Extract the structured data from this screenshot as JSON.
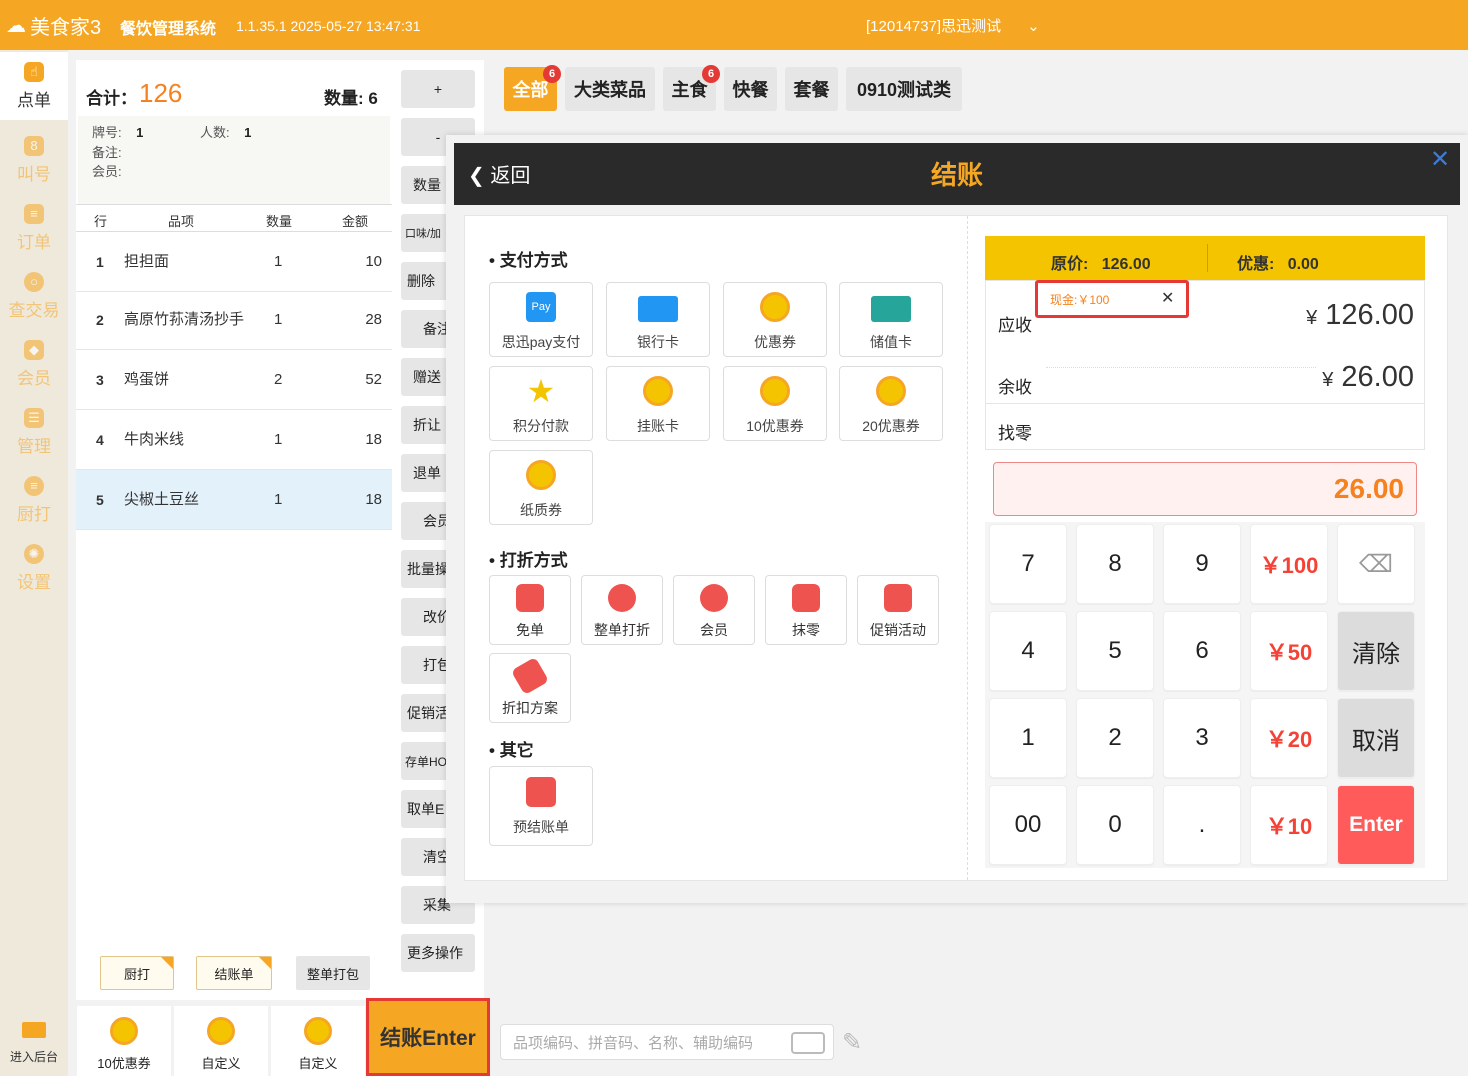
{
  "topbar": {
    "logo": "美食家3",
    "system_name": "餐饮管理系统",
    "version": "1.1.35.1 2025-05-27 13:47:31",
    "store": "[12014737]思迅测试",
    "chevron": "⌄"
  },
  "nav": {
    "items": [
      {
        "label": "点单",
        "icon": "hand-pointer-icon"
      },
      {
        "label": "叫号",
        "icon": "number-icon"
      },
      {
        "label": "订单",
        "icon": "document-icon"
      },
      {
        "label": "查交易",
        "icon": "search-icon"
      },
      {
        "label": "会员",
        "icon": "diamond-icon"
      },
      {
        "label": "管理",
        "icon": "list-icon"
      },
      {
        "label": "厨打",
        "icon": "chef-icon"
      },
      {
        "label": "设置",
        "icon": "gear-icon"
      }
    ],
    "backend": "进入后台"
  },
  "order": {
    "total_label": "合计：",
    "total": "126",
    "qty_label": "数量:",
    "qty": "6",
    "table_label": "牌号:",
    "table_no": "1",
    "people_label": "人数:",
    "people": "1",
    "remark_label": "备注:",
    "member_label": "会员:",
    "columns": [
      "行",
      "品项",
      "数量",
      "金额"
    ],
    "rows": [
      {
        "no": "1",
        "name": "担担面",
        "qty": "1",
        "amount": "10"
      },
      {
        "no": "2",
        "name": "高原竹荪清汤抄手",
        "qty": "1",
        "amount": "28"
      },
      {
        "no": "3",
        "name": "鸡蛋饼",
        "qty": "2",
        "amount": "52"
      },
      {
        "no": "4",
        "name": "牛肉米线",
        "qty": "1",
        "amount": "18"
      },
      {
        "no": "5",
        "name": "尖椒土豆丝",
        "qty": "1",
        "amount": "18"
      }
    ],
    "buttons": {
      "kitchen_print": "厨打",
      "bill": "结账单",
      "packing": "整单打包"
    }
  },
  "bottom_coupons": [
    "10优惠券",
    "自定义",
    "自定义"
  ],
  "actions": [
    "+",
    "-",
    "数量",
    "口味/加",
    "删除",
    "备注",
    "赠送",
    "折让",
    "退单",
    "会员",
    "批量操",
    "改价",
    "打包",
    "促销活",
    "存单HO",
    "取单E",
    "清空",
    "采集",
    "更多操作"
  ],
  "checkout_button": "结账Enter",
  "categories": [
    {
      "label": "全部",
      "badge": "6"
    },
    {
      "label": "大类菜品",
      "badge": ""
    },
    {
      "label": "主食",
      "badge": "6"
    },
    {
      "label": "快餐",
      "badge": ""
    },
    {
      "label": "套餐",
      "badge": ""
    },
    {
      "label": "0910测试类",
      "badge": ""
    }
  ],
  "search": {
    "placeholder": "品项编码、拼音码、名称、辅助编码"
  },
  "modal": {
    "back": "返回",
    "title": "结账",
    "close": "✕",
    "pay_section": "支付方式",
    "pay_methods": [
      {
        "label": "思迅pay支付",
        "icon": "pay-icon",
        "icon_text": "Pay"
      },
      {
        "label": "银行卡",
        "icon": "bank-card-icon"
      },
      {
        "label": "优惠券",
        "icon": "coupon-icon"
      },
      {
        "label": "储值卡",
        "icon": "stored-card-icon"
      },
      {
        "label": "积分付款",
        "icon": "star-icon",
        "icon_text": "★"
      },
      {
        "label": "挂账卡",
        "icon": "coupon-icon"
      },
      {
        "label": "10优惠券",
        "icon": "coupon-icon"
      },
      {
        "label": "20优惠券",
        "icon": "coupon-icon"
      },
      {
        "label": "纸质券",
        "icon": "coupon-icon"
      }
    ],
    "discount_section": "打折方式",
    "discounts": [
      {
        "label": "免单",
        "icon": "free-icon"
      },
      {
        "label": "整单打折",
        "icon": "percent-icon"
      },
      {
        "label": "会员",
        "icon": "member-icon"
      },
      {
        "label": "抹零",
        "icon": "wipe-icon"
      },
      {
        "label": "促销活动",
        "icon": "sale-icon"
      },
      {
        "label": "折扣方案",
        "icon": "tag-icon"
      }
    ],
    "other_section": "其它",
    "others": [
      {
        "label": "预结账单",
        "icon": "wallet-icon"
      }
    ],
    "original_label": "原价:",
    "original": "126.00",
    "discount_label": "优惠:",
    "discount": "0.00",
    "cash_tag": "现金:￥100",
    "cash_tag_close": "✕",
    "receivable_label": "应收",
    "receivable": "126.00",
    "remaining_label": "余收",
    "remaining": "26.00",
    "change_label": "找零",
    "currency": "¥",
    "amount_input": "26.00",
    "keypad": [
      [
        "7",
        "8",
        "9",
        "￥100",
        "⌫"
      ],
      [
        "4",
        "5",
        "6",
        "￥50",
        "清除"
      ],
      [
        "1",
        "2",
        "3",
        "￥20",
        "取消"
      ],
      [
        "00",
        "0",
        ".",
        "￥10",
        "Enter"
      ]
    ]
  },
  "colors": {
    "accent": "#f5a623",
    "highlight": "#e53935",
    "money": "#f44336"
  }
}
